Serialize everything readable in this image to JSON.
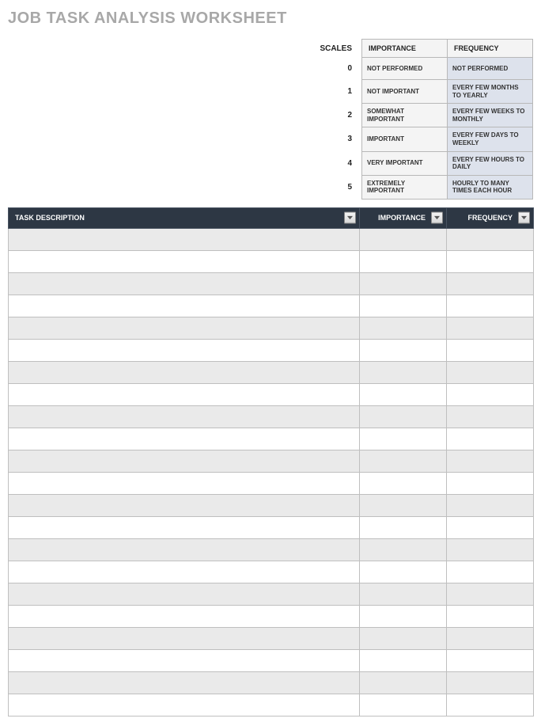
{
  "title": "JOB TASK ANALYSIS WORKSHEET",
  "scales": {
    "label": "SCALES",
    "importanceHeader": "IMPORTANCE",
    "frequencyHeader": "FREQUENCY",
    "rows": [
      {
        "num": "0",
        "importance": "NOT PERFORMED",
        "frequency": "NOT PERFORMED"
      },
      {
        "num": "1",
        "importance": "NOT IMPORTANT",
        "frequency": "EVERY FEW MONTHS TO YEARLY"
      },
      {
        "num": "2",
        "importance": "SOMEWHAT IMPORTANT",
        "frequency": "EVERY FEW WEEKS TO MONTHLY"
      },
      {
        "num": "3",
        "importance": "IMPORTANT",
        "frequency": "EVERY FEW DAYS TO WEEKLY"
      },
      {
        "num": "4",
        "importance": "VERY IMPORTANT",
        "frequency": "EVERY FEW HOURS TO DAILY"
      },
      {
        "num": "5",
        "importance": "EXTREMELY IMPORTANT",
        "frequency": "HOURLY TO MANY TIMES EACH HOUR"
      }
    ]
  },
  "worksheet": {
    "headers": {
      "taskDescription": "TASK DESCRIPTION",
      "importance": "IMPORTANCE",
      "frequency": "FREQUENCY"
    },
    "rowCount": 22
  }
}
